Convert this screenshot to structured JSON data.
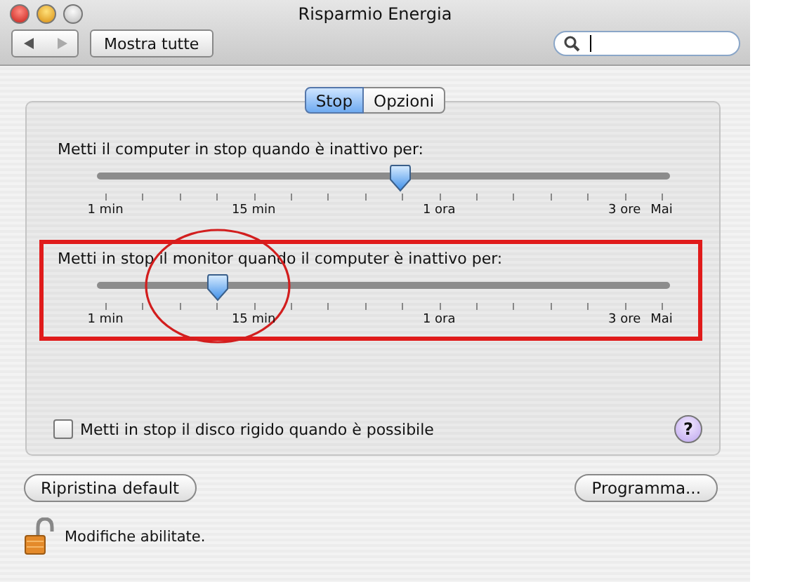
{
  "window": {
    "title": "Risparmio Energia"
  },
  "toolbar": {
    "show_all": "Mostra tutte"
  },
  "tabs": [
    {
      "label": "Stop",
      "selected": true
    },
    {
      "label": "Opzioni",
      "selected": false
    }
  ],
  "sliders": [
    {
      "label": "Metti il computer in stop quando è inattivo per:",
      "level": 0.53,
      "highlighted": false,
      "scale": [
        "1 min",
        "15 min",
        "1 ora",
        "3 ore",
        "Mai"
      ]
    },
    {
      "label": "Metti in stop il monitor quando il computer è inattivo per:",
      "level": 0.21,
      "highlighted": true,
      "scale": [
        "1 min",
        "15 min",
        "1 ora",
        "3 ore",
        "Mai"
      ]
    }
  ],
  "disk_sleep": {
    "label": "Metti in stop il disco rigido quando è possibile",
    "checked": false
  },
  "help": "?",
  "buttons": {
    "restore": "Ripristina default",
    "schedule": "Programma..."
  },
  "lock": {
    "text": "Modifiche abilitate.",
    "locked": false
  }
}
